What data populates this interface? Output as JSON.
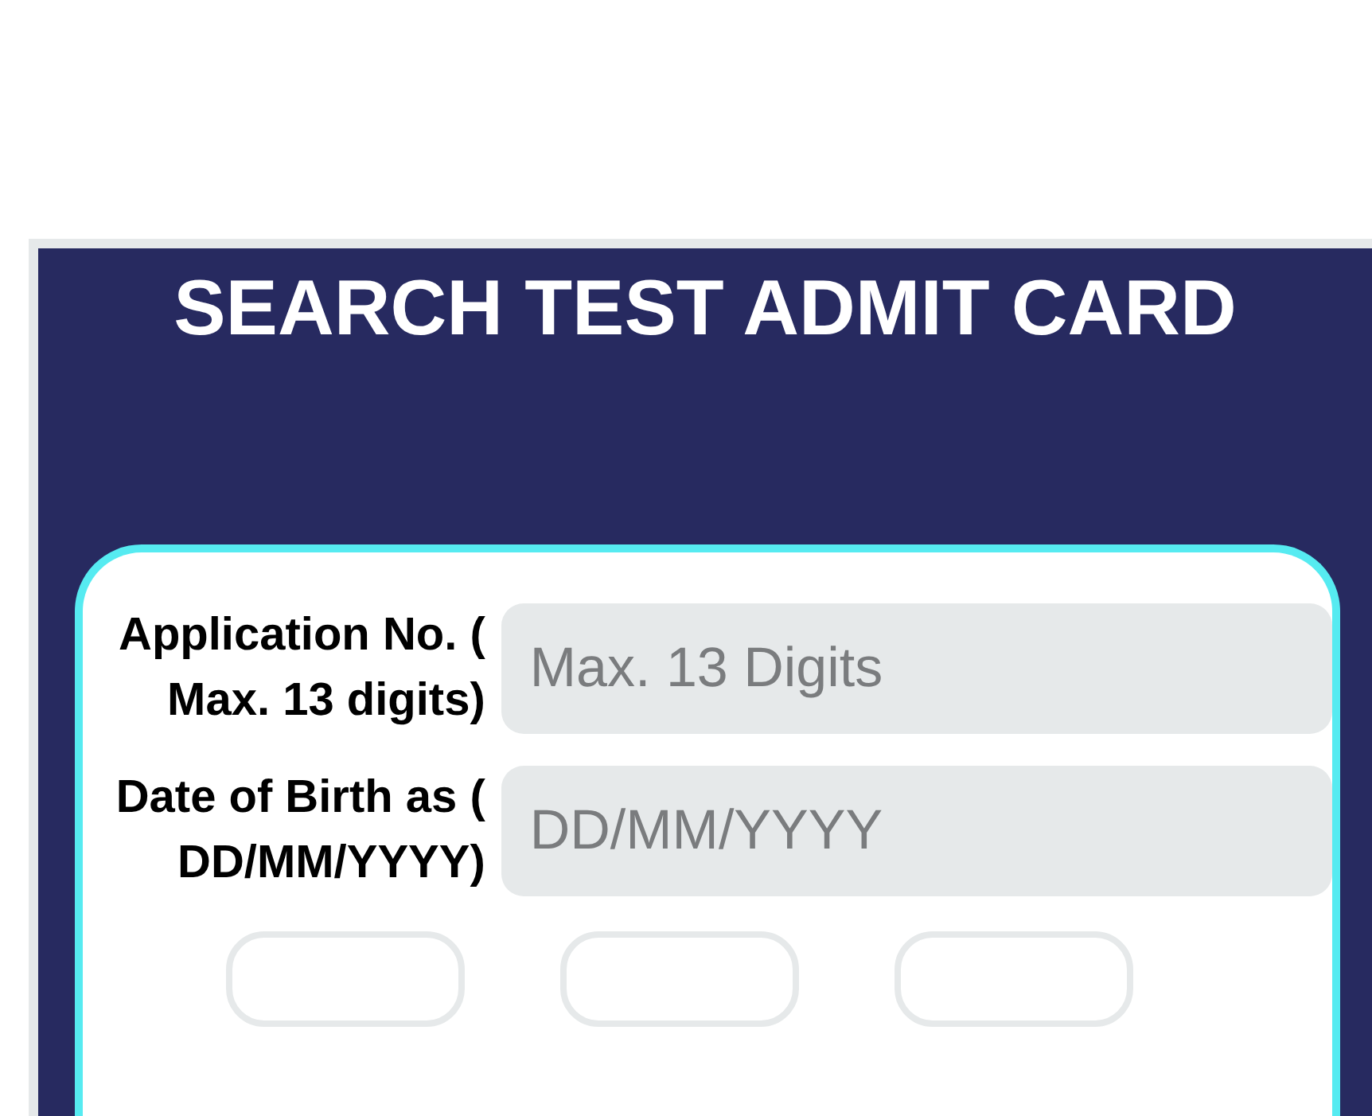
{
  "title": "SEARCH TEST ADMIT CARD",
  "fields": [
    {
      "label": "Application No. ( Max. 13 digits)",
      "placeholder": "Max. 13 Digits"
    },
    {
      "label": "Date of Birth as ( DD/MM/YYYY)",
      "placeholder": "DD/MM/YYYY"
    }
  ]
}
